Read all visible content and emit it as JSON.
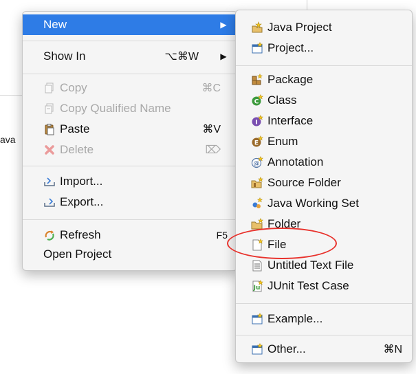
{
  "background": {
    "fragment_text": "ava"
  },
  "context_menu": {
    "items": [
      {
        "label": "New",
        "shortcut": "",
        "arrow": "▶"
      },
      {
        "label": "Show In",
        "shortcut": "⌥⌘W",
        "arrow": "▶"
      },
      {
        "label": "Copy",
        "shortcut": "⌘C"
      },
      {
        "label": "Copy Qualified Name",
        "shortcut": ""
      },
      {
        "label": "Paste",
        "shortcut": "⌘V"
      },
      {
        "label": "Delete",
        "shortcut": "⌦"
      },
      {
        "label": "Import...",
        "shortcut": ""
      },
      {
        "label": "Export...",
        "shortcut": ""
      },
      {
        "label": "Refresh",
        "shortcut": "F5"
      },
      {
        "label": "Open Project",
        "shortcut": ""
      }
    ]
  },
  "new_submenu": {
    "items": [
      {
        "label": "Java Project"
      },
      {
        "label": "Project..."
      },
      {
        "label": "Package"
      },
      {
        "label": "Class"
      },
      {
        "label": "Interface"
      },
      {
        "label": "Enum"
      },
      {
        "label": "Annotation"
      },
      {
        "label": "Source Folder"
      },
      {
        "label": "Java Working Set"
      },
      {
        "label": "Folder"
      },
      {
        "label": "File"
      },
      {
        "label": "Untitled Text File"
      },
      {
        "label": "JUnit Test Case"
      },
      {
        "label": "Example..."
      },
      {
        "label": "Other...",
        "shortcut": "⌘N"
      }
    ]
  },
  "colors": {
    "highlight": "#2e7ce6",
    "annotation_circle": "#e8322c"
  }
}
